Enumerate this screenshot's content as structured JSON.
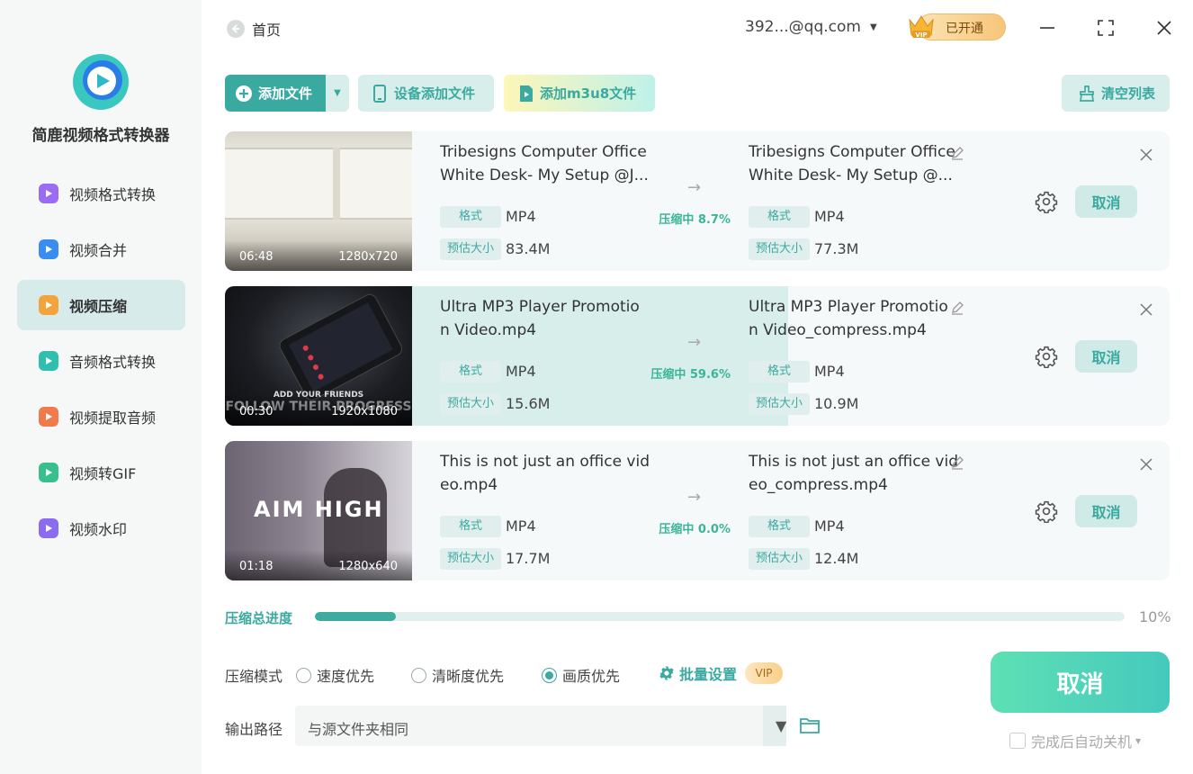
{
  "app": {
    "name": "简鹿视频格式转换器"
  },
  "sidebar": {
    "items": [
      {
        "label": "视频格式转换",
        "icon": "video-convert-icon",
        "active": false
      },
      {
        "label": "视频合并",
        "icon": "video-merge-icon",
        "active": false
      },
      {
        "label": "视频压缩",
        "icon": "video-compress-icon",
        "active": true
      },
      {
        "label": "音频格式转换",
        "icon": "audio-convert-icon",
        "active": false
      },
      {
        "label": "视频提取音频",
        "icon": "extract-audio-icon",
        "active": false
      },
      {
        "label": "视频转GIF",
        "icon": "gif-icon",
        "active": false
      },
      {
        "label": "视频水印",
        "icon": "watermark-icon",
        "active": false
      }
    ]
  },
  "header": {
    "back_label": "首页",
    "account": "392...@qq.com",
    "vip_label": "已开通",
    "vip_badge": "VIP"
  },
  "toolbar": {
    "add_file": "添加文件",
    "add_device": "设备添加文件",
    "add_m3u8": "添加m3u8文件",
    "clear": "清空列表"
  },
  "labels": {
    "format": "格式",
    "size": "预估大小",
    "cancel": "取消"
  },
  "files": [
    {
      "src_name": [
        "Tribesigns Computer Office",
        "White Desk- My Setup @J..."
      ],
      "dst_name": [
        "Tribesigns Computer Office",
        "White Desk- My Setup @..."
      ],
      "duration": "06:48",
      "resolution": "1280x720",
      "src_format": "MP4",
      "src_size": "83.4M",
      "dst_format": "MP4",
      "dst_size": "77.3M",
      "status": "压缩中 8.7%",
      "progress": 0.087
    },
    {
      "src_name": [
        "Ultra MP3 Player Promotio",
        "n Video.mp4"
      ],
      "dst_name": [
        "Ultra MP3 Player Promotio",
        "n Video_compress.mp4"
      ],
      "duration": "00:30",
      "resolution": "1920x1080",
      "src_format": "MP4",
      "src_size": "15.6M",
      "dst_format": "MP4",
      "dst_size": "10.9M",
      "status": "压缩中 59.6%",
      "progress": 0.596,
      "thumb_text": [
        "ADD YOUR FRIENDS",
        "FOLLOW THEIR PROGRESS"
      ]
    },
    {
      "src_name": [
        "This is not just an office vid",
        "eo.mp4"
      ],
      "dst_name": [
        "This is not just an office vid",
        "eo_compress.mp4"
      ],
      "duration": "01:18",
      "resolution": "1280x640",
      "src_format": "MP4",
      "src_size": "17.7M",
      "dst_format": "MP4",
      "dst_size": "12.4M",
      "status": "压缩中 0.0%",
      "progress": 0.0,
      "thumb_text": [
        "AIM HIGH"
      ]
    }
  ],
  "total": {
    "label": "压缩总进度",
    "percent_text": "10%",
    "progress": 0.1
  },
  "mode": {
    "label": "压缩模式",
    "options": [
      "速度优先",
      "清晰度优先",
      "画质优先"
    ],
    "selected": "画质优先",
    "batch": "批量设置",
    "vip": "VIP"
  },
  "output": {
    "label": "输出路径",
    "value": "与源文件夹相同"
  },
  "actions": {
    "cancel_all": "取消",
    "auto_shutdown": "完成后自动关机"
  },
  "colors": {
    "accent": "#3aa9a0",
    "progress_bg": "#d7eeeb"
  }
}
